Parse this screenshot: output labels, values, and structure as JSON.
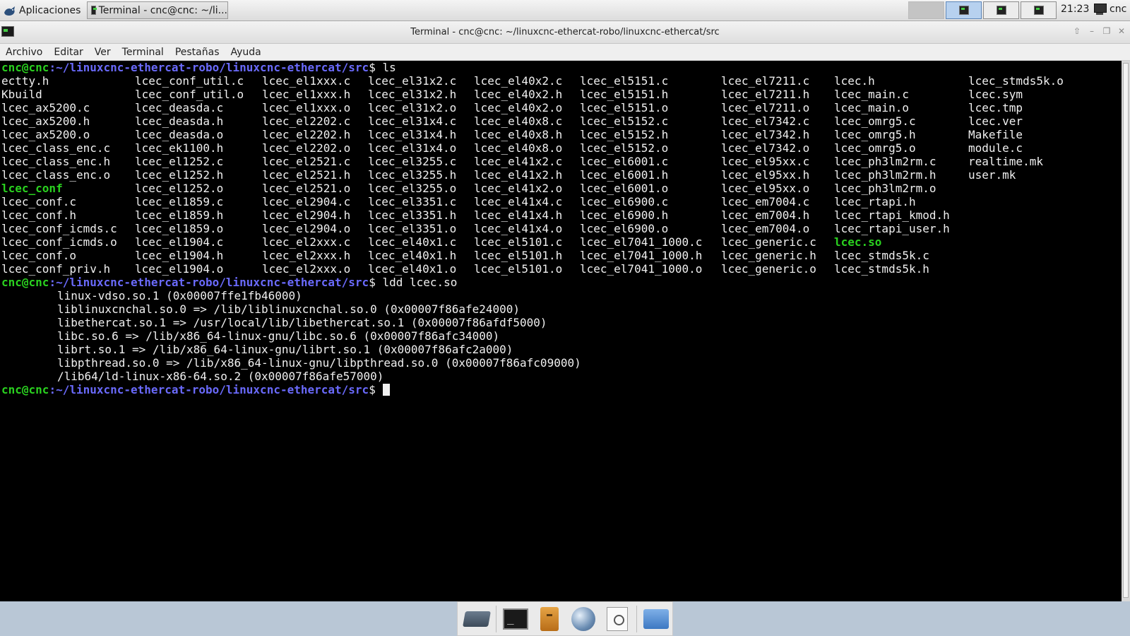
{
  "top_panel": {
    "apps_menu_label": "Aplicaciones",
    "task_button_label": "Terminal - cnc@cnc: ~/li...",
    "clock": "21:23",
    "user": "cnc"
  },
  "window": {
    "title": "Terminal - cnc@cnc: ~/linuxcnc-ethercat-robo/linuxcnc-ethercat/src",
    "menu": [
      "Archivo",
      "Editar",
      "Ver",
      "Terminal",
      "Pestañas",
      "Ayuda"
    ]
  },
  "terminal": {
    "prompt_user": "cnc@cnc",
    "prompt_path": ":~/linuxcnc-ethercat-robo/linuxcnc-ethercat/src",
    "prompt_symbol": "$ ",
    "cmd1": "ls",
    "cmd2": "ldd lcec.so",
    "ls_columns": [
      [
        "ectty.h",
        "Kbuild",
        "lcec_ax5200.c",
        "lcec_ax5200.h",
        "lcec_ax5200.o",
        "lcec_class_enc.c",
        "lcec_class_enc.h",
        "lcec_class_enc.o",
        "lcec_conf",
        "lcec_conf.c",
        "lcec_conf.h",
        "lcec_conf_icmds.c",
        "lcec_conf_icmds.o",
        "lcec_conf.o",
        "lcec_conf_priv.h"
      ],
      [
        "lcec_conf_util.c",
        "lcec_conf_util.o",
        "lcec_deasda.c",
        "lcec_deasda.h",
        "lcec_deasda.o",
        "lcec_ek1100.h",
        "lcec_el1252.c",
        "lcec_el1252.h",
        "lcec_el1252.o",
        "lcec_el1859.c",
        "lcec_el1859.h",
        "lcec_el1859.o",
        "lcec_el1904.c",
        "lcec_el1904.h",
        "lcec_el1904.o"
      ],
      [
        "lcec_el1xxx.c",
        "lcec_el1xxx.h",
        "lcec_el1xxx.o",
        "lcec_el2202.c",
        "lcec_el2202.h",
        "lcec_el2202.o",
        "lcec_el2521.c",
        "lcec_el2521.h",
        "lcec_el2521.o",
        "lcec_el2904.c",
        "lcec_el2904.h",
        "lcec_el2904.o",
        "lcec_el2xxx.c",
        "lcec_el2xxx.h",
        "lcec_el2xxx.o"
      ],
      [
        "lcec_el31x2.c",
        "lcec_el31x2.h",
        "lcec_el31x2.o",
        "lcec_el31x4.c",
        "lcec_el31x4.h",
        "lcec_el31x4.o",
        "lcec_el3255.c",
        "lcec_el3255.h",
        "lcec_el3255.o",
        "lcec_el3351.c",
        "lcec_el3351.h",
        "lcec_el3351.o",
        "lcec_el40x1.c",
        "lcec_el40x1.h",
        "lcec_el40x1.o"
      ],
      [
        "lcec_el40x2.c",
        "lcec_el40x2.h",
        "lcec_el40x2.o",
        "lcec_el40x8.c",
        "lcec_el40x8.h",
        "lcec_el40x8.o",
        "lcec_el41x2.c",
        "lcec_el41x2.h",
        "lcec_el41x2.o",
        "lcec_el41x4.c",
        "lcec_el41x4.h",
        "lcec_el41x4.o",
        "lcec_el5101.c",
        "lcec_el5101.h",
        "lcec_el5101.o"
      ],
      [
        "lcec_el5151.c",
        "lcec_el5151.h",
        "lcec_el5151.o",
        "lcec_el5152.c",
        "lcec_el5152.h",
        "lcec_el5152.o",
        "lcec_el6001.c",
        "lcec_el6001.h",
        "lcec_el6001.o",
        "lcec_el6900.c",
        "lcec_el6900.h",
        "lcec_el6900.o",
        "lcec_el7041_1000.c",
        "lcec_el7041_1000.h",
        "lcec_el7041_1000.o"
      ],
      [
        "lcec_el7211.c",
        "lcec_el7211.h",
        "lcec_el7211.o",
        "lcec_el7342.c",
        "lcec_el7342.h",
        "lcec_el7342.o",
        "lcec_el95xx.c",
        "lcec_el95xx.h",
        "lcec_el95xx.o",
        "lcec_em7004.c",
        "lcec_em7004.h",
        "lcec_em7004.o",
        "lcec_generic.c",
        "lcec_generic.h",
        "lcec_generic.o"
      ],
      [
        "lcec.h",
        "lcec_main.c",
        "lcec_main.o",
        "lcec_omrg5.c",
        "lcec_omrg5.h",
        "lcec_omrg5.o",
        "lcec_ph3lm2rm.c",
        "lcec_ph3lm2rm.h",
        "lcec_ph3lm2rm.o",
        "lcec_rtapi.h",
        "lcec_rtapi_kmod.h",
        "lcec_rtapi_user.h",
        "lcec.so",
        "lcec_stmds5k.c",
        "lcec_stmds5k.h"
      ],
      [
        "lcec_stmds5k.o",
        "lcec.sym",
        "lcec.tmp",
        "lcec.ver",
        "Makefile",
        "module.c",
        "realtime.mk",
        "user.mk"
      ]
    ],
    "executables": [
      "lcec_conf",
      "lcec.so"
    ],
    "ldd_output": [
      "linux-vdso.so.1 (0x00007ffe1fb46000)",
      "liblinuxcnchal.so.0 => /lib/liblinuxcnchal.so.0 (0x00007f86afe24000)",
      "libethercat.so.1 => /usr/local/lib/libethercat.so.1 (0x00007f86afdf5000)",
      "libc.so.6 => /lib/x86_64-linux-gnu/libc.so.6 (0x00007f86afc34000)",
      "librt.so.1 => /lib/x86_64-linux-gnu/librt.so.1 (0x00007f86afc2a000)",
      "libpthread.so.0 => /lib/x86_64-linux-gnu/libpthread.so.0 (0x00007f86afc09000)",
      "/lib64/ld-linux-x86-64.so.2 (0x00007f86afe57000)"
    ]
  },
  "dock": {
    "items": [
      "desktop-icon",
      "terminal-icon",
      "file-cabinet-icon",
      "web-browser-icon",
      "app-finder-icon",
      "folder-icon"
    ]
  },
  "colors": {
    "prompt_user": "#2ad11f",
    "prompt_path": "#6a6afc",
    "terminal_bg": "#000000",
    "terminal_fg": "#f0f0f0"
  }
}
